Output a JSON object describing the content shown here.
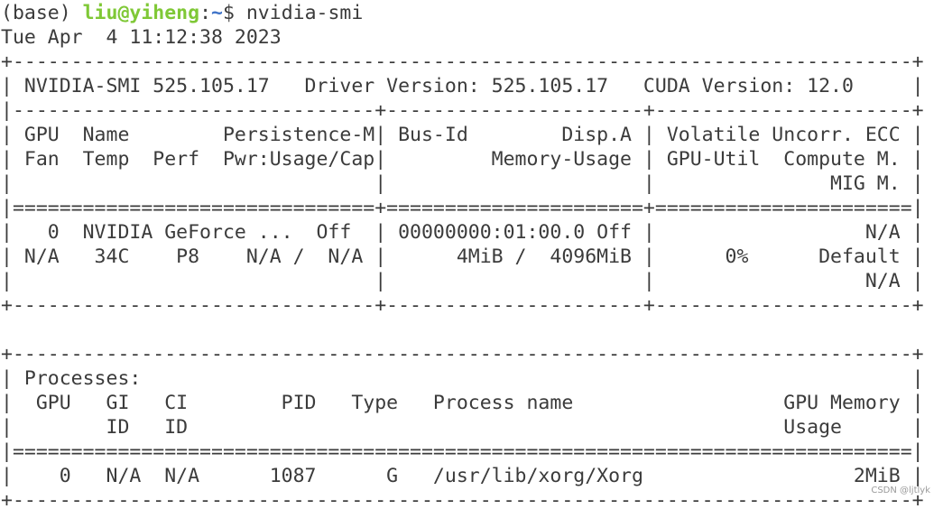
{
  "terminal": {
    "prompt": {
      "env": "(base) ",
      "user_host": "liu@yiheng",
      "separator": ":",
      "cwd": "~",
      "symbol": "$ ",
      "command": "nvidia-smi"
    },
    "output": [
      "Tue Apr  4 11:12:38 2023",
      "+-----------------------------------------------------------------------------+",
      "| NVIDIA-SMI 525.105.17   Driver Version: 525.105.17   CUDA Version: 12.0     |",
      "|-------------------------------+----------------------+----------------------+",
      "| GPU  Name        Persistence-M| Bus-Id        Disp.A | Volatile Uncorr. ECC |",
      "| Fan  Temp  Perf  Pwr:Usage/Cap|         Memory-Usage | GPU-Util  Compute M. |",
      "|                               |                      |               MIG M. |",
      "|===============================+======================+======================|",
      "|   0  NVIDIA GeForce ...  Off  | 00000000:01:00.0 Off |                  N/A |",
      "| N/A   34C    P8    N/A /  N/A |      4MiB /  4096MiB |      0%      Default |",
      "|                               |                      |                  N/A |",
      "+-------------------------------+----------------------+----------------------+",
      "",
      "+-----------------------------------------------------------------------------+",
      "| Processes:                                                                  |",
      "|  GPU   GI   CI        PID   Type   Process name                  GPU Memory |",
      "|        ID   ID                                                   Usage      |",
      "|=============================================================================|",
      "|    0   N/A  N/A      1087      G   /usr/lib/xorg/Xorg                  2MiB |",
      "+-----------------------------------------------------------------------------+"
    ]
  },
  "watermark": "CSDN @ljtlyk"
}
